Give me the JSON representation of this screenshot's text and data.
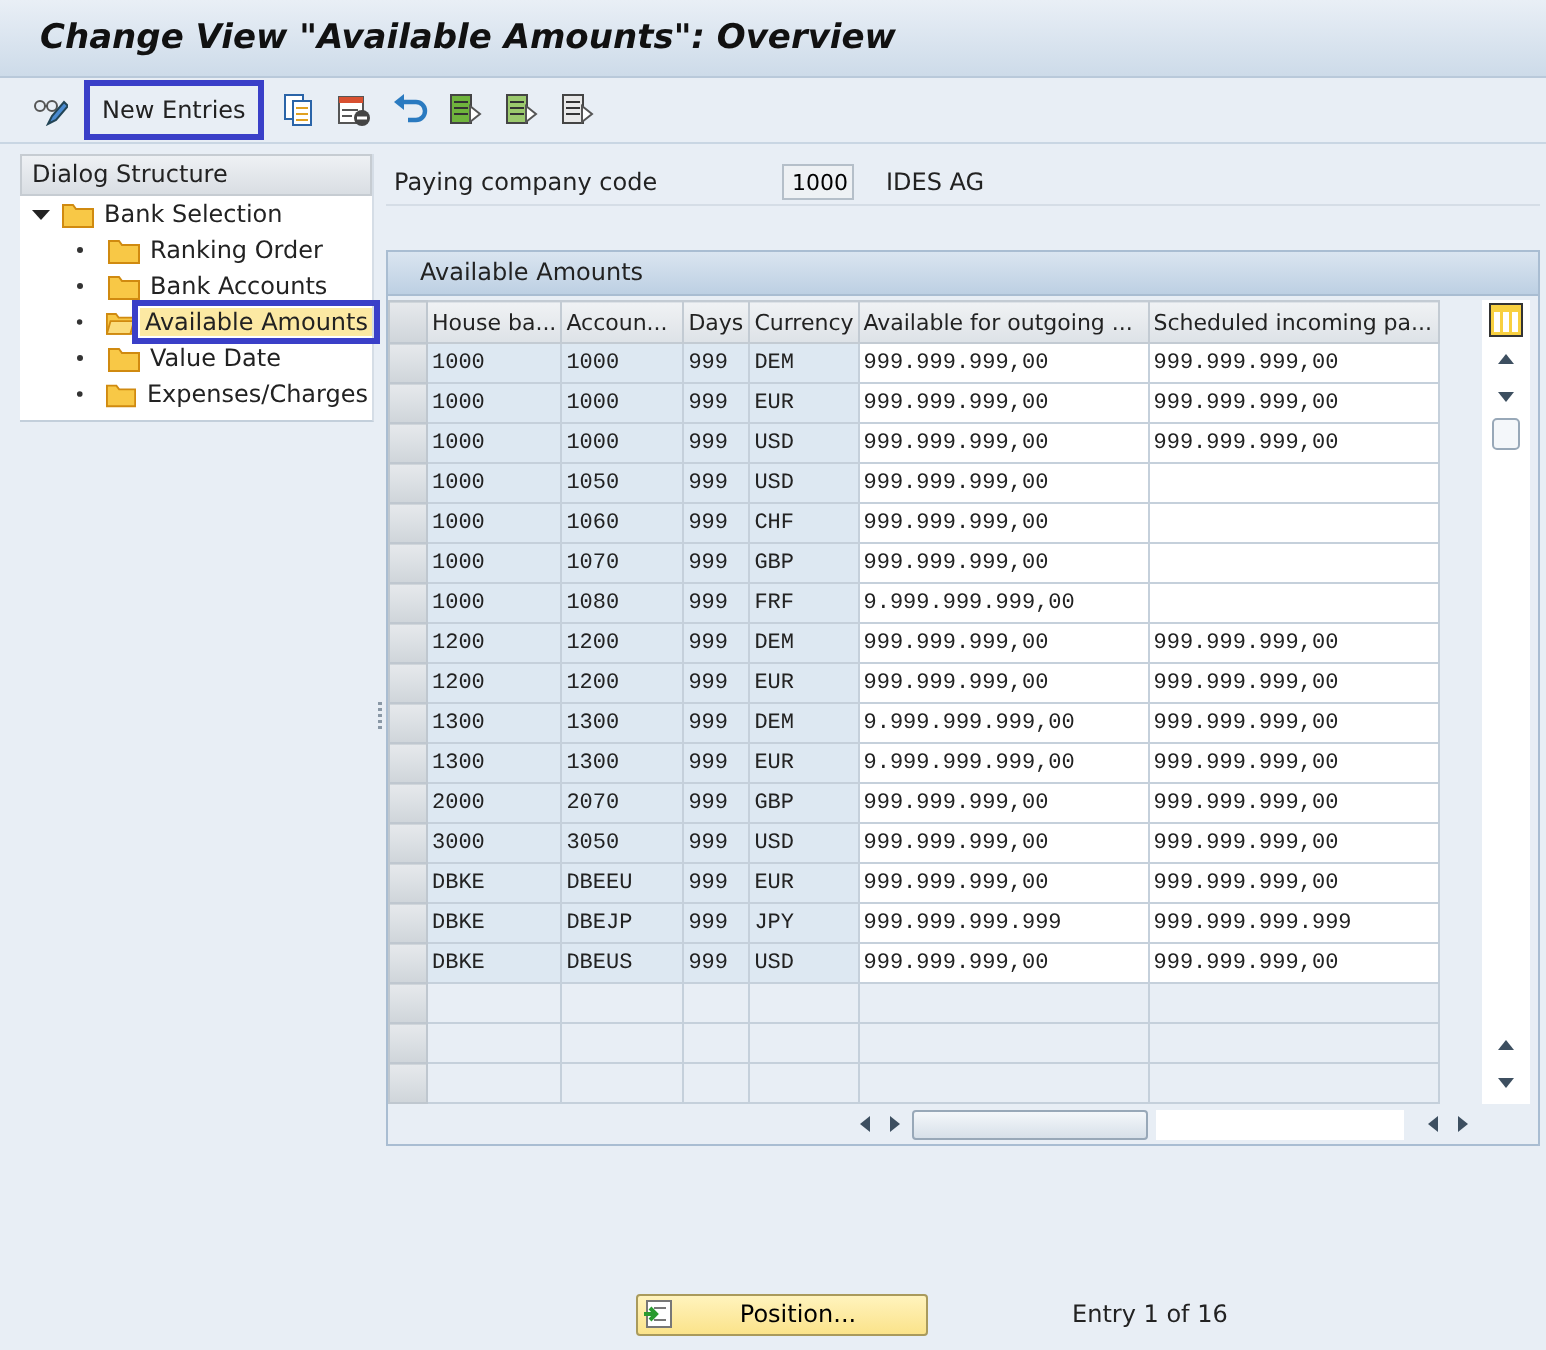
{
  "window": {
    "title": "Change View \"Available Amounts\": Overview"
  },
  "toolbar": {
    "new_entries": {
      "label": "New Entries",
      "highlighted": true
    }
  },
  "tree": {
    "title": "Dialog Structure",
    "items": [
      {
        "label": "Bank Selection",
        "expanded": true,
        "selected": false,
        "children": [
          {
            "label": "Ranking Order",
            "selected": false
          },
          {
            "label": "Bank Accounts",
            "selected": false
          },
          {
            "label": "Available Amounts",
            "selected": true
          },
          {
            "label": "Value Date",
            "selected": false
          },
          {
            "label": "Expenses/Charges",
            "selected": false
          }
        ]
      }
    ]
  },
  "header": {
    "label": "Paying company code",
    "value": "1000",
    "description": "IDES AG"
  },
  "table": {
    "title": "Available Amounts",
    "columns": [
      "House ba...",
      "Accoun...",
      "Days",
      "Currency",
      "Available for outgoing ...",
      "Scheduled incoming pa..."
    ],
    "rows": [
      [
        "1000",
        "1000",
        "999",
        "DEM",
        "999.999.999,00",
        "999.999.999,00"
      ],
      [
        "1000",
        "1000",
        "999",
        "EUR",
        "999.999.999,00",
        "999.999.999,00"
      ],
      [
        "1000",
        "1000",
        "999",
        "USD",
        "999.999.999,00",
        "999.999.999,00"
      ],
      [
        "1000",
        "1050",
        "999",
        "USD",
        "999.999.999,00",
        null
      ],
      [
        "1000",
        "1060",
        "999",
        "CHF",
        "999.999.999,00",
        null
      ],
      [
        "1000",
        "1070",
        "999",
        "GBP",
        "999.999.999,00",
        null
      ],
      [
        "1000",
        "1080",
        "999",
        "FRF",
        "9.999.999.999,00",
        null
      ],
      [
        "1200",
        "1200",
        "999",
        "DEM",
        "999.999.999,00",
        "999.999.999,00"
      ],
      [
        "1200",
        "1200",
        "999",
        "EUR",
        "999.999.999,00",
        "999.999.999,00"
      ],
      [
        "1300",
        "1300",
        "999",
        "DEM",
        "9.999.999.999,00",
        "999.999.999,00"
      ],
      [
        "1300",
        "1300",
        "999",
        "EUR",
        "9.999.999.999,00",
        "999.999.999,00"
      ],
      [
        "2000",
        "2070",
        "999",
        "GBP",
        "999.999.999,00",
        "999.999.999,00"
      ],
      [
        "3000",
        "3050",
        "999",
        "USD",
        "999.999.999,00",
        "999.999.999,00"
      ],
      [
        "DBKE",
        "DBEEU",
        "999",
        "EUR",
        "999.999.999,00",
        "999.999.999,00"
      ],
      [
        "DBKE",
        "DBEJP",
        "999",
        "JPY",
        "999.999.999.999",
        "999.999.999.999"
      ],
      [
        "DBKE",
        "DBEUS",
        "999",
        "USD",
        "999.999.999,00",
        "999.999.999,00"
      ]
    ]
  },
  "footer": {
    "position_button": "Position...",
    "entry_info": "Entry 1 of 16"
  }
}
